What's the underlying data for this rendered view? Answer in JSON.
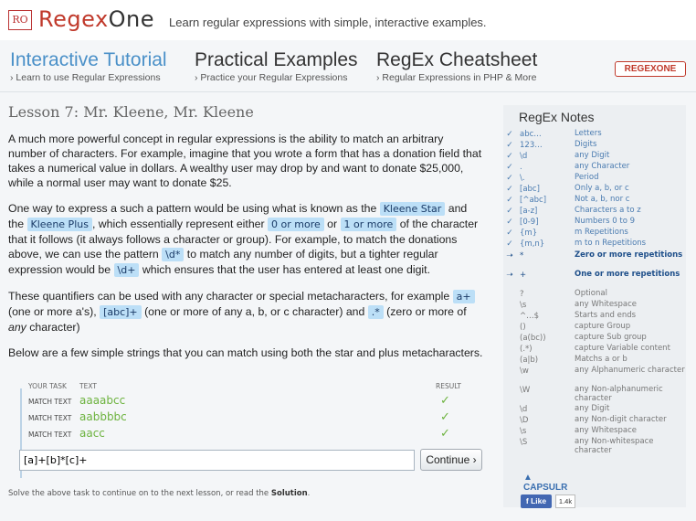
{
  "header": {
    "logo_mark": "RO",
    "logo_text_prefix": "Regex",
    "logo_text_suffix": "One",
    "tagline": "Learn regular expressions with simple, interactive examples."
  },
  "nav": [
    {
      "title": "Interactive Tutorial",
      "subtitle": "› Learn to use Regular Expressions",
      "active": true
    },
    {
      "title": "Practical Examples",
      "subtitle": "› Practice your Regular Expressions",
      "active": false
    },
    {
      "title": "RegEx Cheatsheet",
      "subtitle": "› Regular Expressions in PHP & More",
      "active": false
    }
  ],
  "brand_badge": "REGEXONE",
  "lesson": {
    "title": "Lesson 7: Mr. Kleene, Mr. Kleene",
    "para1": "A much more powerful concept in regular expressions is the ability to match an arbitrary number of characters. For example, imagine that you wrote a form that has a donation field that takes a numerical value in dollars. A wealthy user may drop by and want to donate $25,000, while a normal user may want to donate $25.",
    "p2": {
      "t1": "One way to express a such a pattern would be using what is known as the ",
      "c1": "Kleene Star",
      "t2": " and the ",
      "c2": "Kleene Plus",
      "t3": ", which essentially represent either ",
      "c3": "0 or more",
      "t4": " or ",
      "c4": "1 or more",
      "t5": " of the character that it follows (it always follows a character or group). For example, to match the donations above, we can use the pattern ",
      "c5": "\\d*",
      "t6": " to match any number of digits, but a tighter regular expression would be ",
      "c6": "\\d+",
      "t7": " which ensures that the user has entered at least one digit."
    },
    "p3": {
      "t1": "These quantifiers can be used with any character or special metacharacters, for example ",
      "c1": "a+",
      "t2": " (one or more a's), ",
      "c2": "[abc]+",
      "t3": " (one or more of any a, b, or c character) and ",
      "c3": ".*",
      "t4": " (zero or more of ",
      "em": "any",
      "t5": " character)"
    },
    "para4": "Below are a few simple strings that you can match using both the star and plus metacharacters."
  },
  "task": {
    "col_task": "YOUR TASK",
    "col_text": "TEXT",
    "col_result": "RESULT",
    "rows": [
      {
        "label": "MATCH TEXT",
        "text": "aaaabcc",
        "result": "✓"
      },
      {
        "label": "MATCH TEXT",
        "text": "aabbbbc",
        "result": "✓"
      },
      {
        "label": "MATCH TEXT",
        "text": "aacc",
        "result": "✓"
      }
    ],
    "input_value": "[a]+[b]*[c]+",
    "continue_label": "Continue ›"
  },
  "footer_note": {
    "text": "Solve the above task to continue on to the next lesson, or read the ",
    "link": "Solution",
    "end": "."
  },
  "notes": {
    "title": "RegEx Notes",
    "items": [
      {
        "mark": "✓",
        "sym": "abc…",
        "desc": "Letters",
        "state": "done"
      },
      {
        "mark": "✓",
        "sym": "123…",
        "desc": "Digits",
        "state": "done"
      },
      {
        "mark": "✓",
        "sym": "\\d",
        "desc": "any Digit",
        "state": "done"
      },
      {
        "mark": "✓",
        "sym": ".",
        "desc": "any Character",
        "state": "done"
      },
      {
        "mark": "✓",
        "sym": "\\.",
        "desc": "Period",
        "state": "done"
      },
      {
        "mark": "✓",
        "sym": "[abc]",
        "desc": "Only a, b, or c",
        "state": "done"
      },
      {
        "mark": "✓",
        "sym": "[^abc]",
        "desc": "Not a, b, nor c",
        "state": "done"
      },
      {
        "mark": "✓",
        "sym": "[a-z]",
        "desc": "Characters a to z",
        "state": "done"
      },
      {
        "mark": "✓",
        "sym": "[0-9]",
        "desc": "Numbers 0 to 9",
        "state": "done"
      },
      {
        "mark": "✓",
        "sym": "{m}",
        "desc": "m Repetitions",
        "state": "done"
      },
      {
        "mark": "✓",
        "sym": "{m,n}",
        "desc": "m to n Repetitions",
        "state": "done"
      },
      {
        "mark": "➝",
        "sym": "*",
        "desc": "Zero or more repetitions",
        "state": "current"
      },
      {
        "mark": "➝",
        "sym": "+",
        "desc": "One or more repetitions",
        "state": "current"
      },
      {
        "mark": "",
        "sym": "?",
        "desc": "Optional",
        "state": "future"
      },
      {
        "mark": "",
        "sym": "\\s",
        "desc": "any Whitespace",
        "state": "future"
      },
      {
        "mark": "",
        "sym": "^…$",
        "desc": "Starts and ends",
        "state": "future"
      },
      {
        "mark": "",
        "sym": "()",
        "desc": "capture Group",
        "state": "future"
      },
      {
        "mark": "",
        "sym": "(a(bc))",
        "desc": "capture Sub group",
        "state": "future"
      },
      {
        "mark": "",
        "sym": "(.*)",
        "desc": "capture Variable content",
        "state": "future"
      },
      {
        "mark": "",
        "sym": "(a|b)",
        "desc": "Matchs a or b",
        "state": "future"
      },
      {
        "mark": "",
        "sym": "\\w",
        "desc": "any Alphanumeric character",
        "state": "future"
      },
      {
        "mark": "",
        "sym": "\\W",
        "desc": "any Non-alphanumeric character",
        "state": "future"
      },
      {
        "mark": "",
        "sym": "\\d",
        "desc": "any Digit",
        "state": "future"
      },
      {
        "mark": "",
        "sym": "\\D",
        "desc": "any Non-digit character",
        "state": "future"
      },
      {
        "mark": "",
        "sym": "\\s",
        "desc": "any Whitespace",
        "state": "future"
      },
      {
        "mark": "",
        "sym": "\\S",
        "desc": "any Non-whitespace character",
        "state": "future"
      }
    ]
  },
  "social": {
    "capsulr": "CAPSULR",
    "like": "Like",
    "like_count": "1.4k"
  },
  "colors": {
    "accent": "#4a90c8",
    "highlight": "#bcdff7",
    "success": "#6db33f",
    "brand_red": "#c0392b"
  }
}
